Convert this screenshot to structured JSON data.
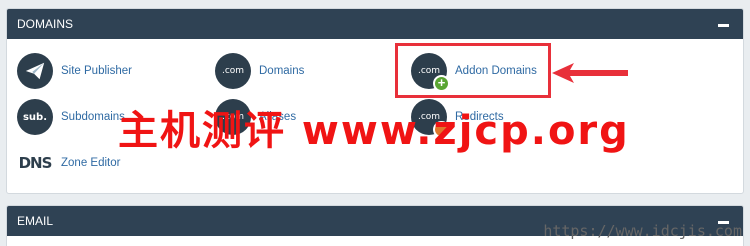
{
  "domains_panel": {
    "title": "DOMAINS",
    "items": [
      {
        "label": "Site Publisher",
        "icon": "paper-plane-icon"
      },
      {
        "label": "Domains",
        "icon": "dotcom-icon",
        "icon_text": ".com"
      },
      {
        "label": "Addon Domains",
        "icon": "dotcom-add-icon",
        "icon_text": ".com"
      },
      {
        "label": "Subdomains",
        "icon": "subdomain-icon",
        "icon_text": "sub."
      },
      {
        "label": "Aliases",
        "icon": "dotcom-alias-icon",
        "icon_text": ".com"
      },
      {
        "label": "Redirects",
        "icon": "dotcom-redirect-icon",
        "icon_text": ".com"
      },
      {
        "label": "Zone Editor",
        "icon": "dns-icon",
        "icon_text": "DNS"
      }
    ]
  },
  "email_panel": {
    "title": "EMAIL"
  },
  "watermark": {
    "text": "主机测评 www.zjcp.org",
    "url": "https://www.idcjis.com"
  },
  "colors": {
    "header_bg": "#2f4254",
    "link": "#2f6aa3",
    "highlight": "#e8303a",
    "add_badge": "#5aa532"
  }
}
